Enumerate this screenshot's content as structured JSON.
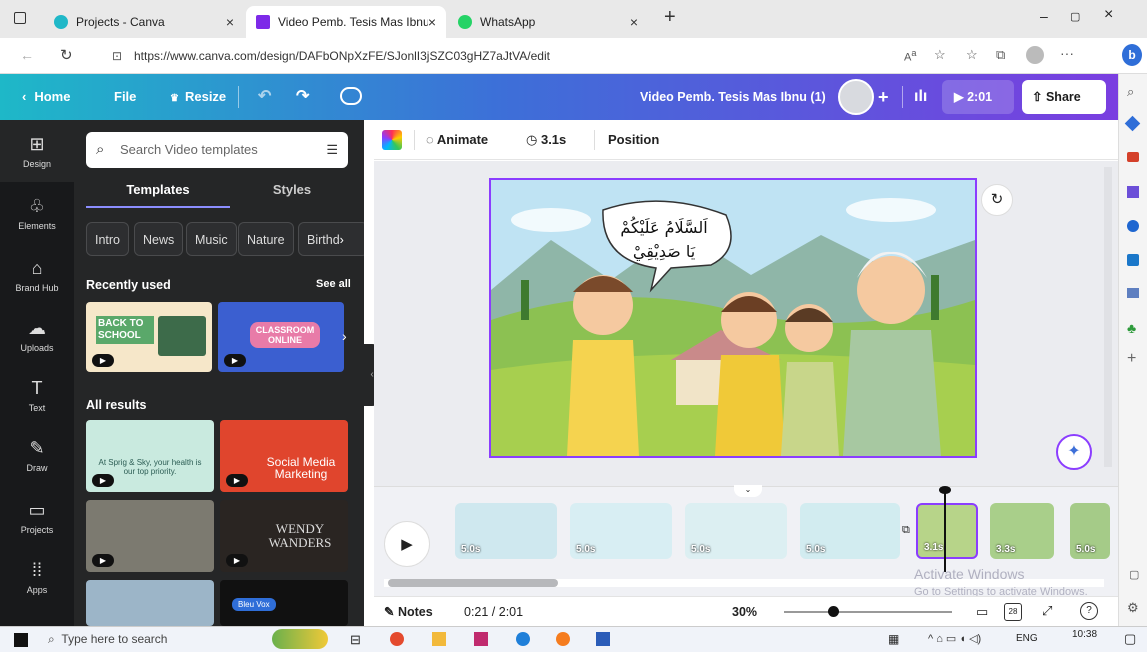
{
  "browser": {
    "tabs": [
      {
        "label": "Projects - Canva",
        "color": "#20b8c8",
        "active": false
      },
      {
        "label": "Video Pemb. Tesis Mas Ibnu (1) -",
        "color": "#7d2ae8",
        "active": true
      },
      {
        "label": "WhatsApp",
        "color": "#25d366",
        "active": false
      }
    ],
    "url": "https://www.canva.com/design/DAFbONpXzFE/SJonlI3jSZC03gHZ7aJtVA/edit"
  },
  "header": {
    "home": "Home",
    "file": "File",
    "resize": "Resize",
    "title": "Video Pemb. Tesis Mas Ibnu (1)",
    "play_time": "2:01",
    "share": "Share"
  },
  "leftnav": [
    {
      "label": "Design",
      "icon": "design-icon",
      "glyph": "⊞"
    },
    {
      "label": "Elements",
      "icon": "elements-icon",
      "glyph": "♧"
    },
    {
      "label": "Brand Hub",
      "icon": "brand-hub-icon",
      "glyph": "⌂"
    },
    {
      "label": "Uploads",
      "icon": "upload-icon",
      "glyph": "☁"
    },
    {
      "label": "Text",
      "icon": "text-icon",
      "glyph": "T"
    },
    {
      "label": "Draw",
      "icon": "draw-icon",
      "glyph": "✎"
    },
    {
      "label": "Projects",
      "icon": "folder-icon",
      "glyph": "▭"
    },
    {
      "label": "Apps",
      "icon": "apps-icon",
      "glyph": "⁞⁞"
    }
  ],
  "panel": {
    "search_placeholder": "Search Video templates",
    "tabs": [
      "Templates",
      "Styles"
    ],
    "chips": [
      "Intro",
      "News",
      "Music",
      "Nature",
      "Birthd"
    ],
    "recently_used": "Recently used",
    "see_all": "See all",
    "all_results": "All results",
    "recent_thumbs": [
      {
        "text": "BACK TO SCHOOL",
        "bg": "#f6e7c9"
      },
      {
        "text": "CLASSROOM ONLINE",
        "bg": "#3b5fd0"
      }
    ],
    "result_thumbs": [
      {
        "text": "At Sprig & Sky, your health is our top priority.",
        "bg": "#c9eadf"
      },
      {
        "text": "Social Media Marketing",
        "bg": "#e0452d"
      },
      {
        "text": "",
        "bg": "#7c7a70"
      },
      {
        "text": "WENDY WANDERS",
        "bg": "#2a2522"
      },
      {
        "text": "",
        "bg": "#9cb5c8"
      },
      {
        "text": "Bleu Vox",
        "bg": "#111111"
      }
    ]
  },
  "toolbar": {
    "animate": "Animate",
    "duration": "3.1s",
    "position": "Position"
  },
  "scene": {
    "bubble_line1": "اَلسَّلَامُ عَلَيْكُمْ",
    "bubble_line2": "يَا صَدِيْقِيْ"
  },
  "timeline": {
    "clips": [
      {
        "dur": "5.0s",
        "bg": "#cfe8ef"
      },
      {
        "dur": "5.0s",
        "bg": "#d8eef3"
      },
      {
        "dur": "5.0s",
        "bg": "#dceff2"
      },
      {
        "dur": "5.0s",
        "bg": "#d2ecf0"
      },
      {
        "dur": "3.1s",
        "bg": "#b7d489"
      },
      {
        "dur": "3.3s",
        "bg": "#a9cf8a"
      },
      {
        "dur": "5.0s",
        "bg": "#a5cb88"
      }
    ]
  },
  "footer": {
    "notes": "Notes",
    "time": "0:21 / 2:01",
    "zoom": "30%",
    "page_num": "28",
    "zoom_level": 0.29
  },
  "watermark": {
    "line1": "Activate Windows",
    "line2": "Go to Settings to activate Windows."
  },
  "taskbar": {
    "search_placeholder": "Type here to search",
    "lang": "ENG",
    "time": "10:38"
  }
}
